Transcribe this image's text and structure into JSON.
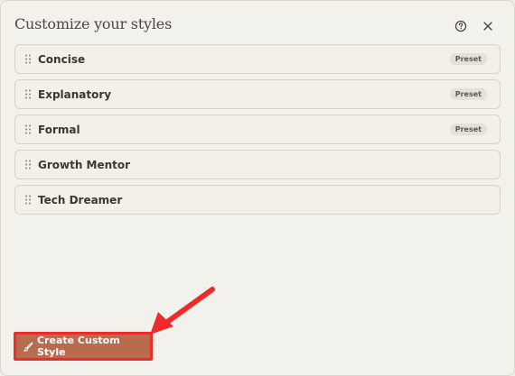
{
  "dialog": {
    "title": "Customize your styles",
    "help_icon": "question-circle-icon",
    "close_icon": "close-icon"
  },
  "styles": [
    {
      "label": "Concise",
      "badge": "Preset"
    },
    {
      "label": "Explanatory",
      "badge": "Preset"
    },
    {
      "label": "Formal",
      "badge": "Preset"
    },
    {
      "label": "Growth Mentor",
      "badge": ""
    },
    {
      "label": "Tech Dreamer",
      "badge": ""
    }
  ],
  "create_button": {
    "label": "Create Custom Style",
    "icon": "brush-icon"
  },
  "colors": {
    "accent": "#b86b4d",
    "annotation": "#ee2b2b"
  }
}
